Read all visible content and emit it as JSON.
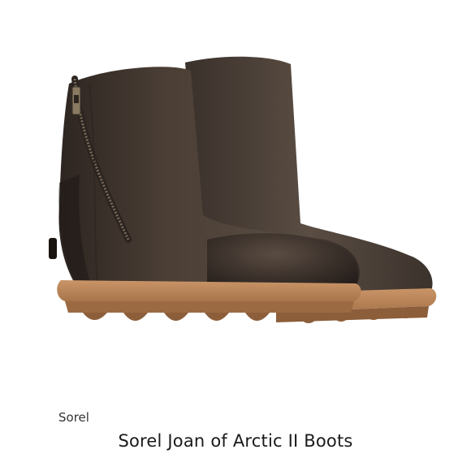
{
  "listing": {
    "brand": "Sorel",
    "title": "Sorel Joan of Arctic II Boots"
  },
  "image": {
    "subject_icon": "ankle-boot-pair-image"
  },
  "colors": {
    "leather": "#4b3f36",
    "leather_dark": "#2e2622",
    "sole": "#c08a5c",
    "tread": "#8c5e3a"
  }
}
